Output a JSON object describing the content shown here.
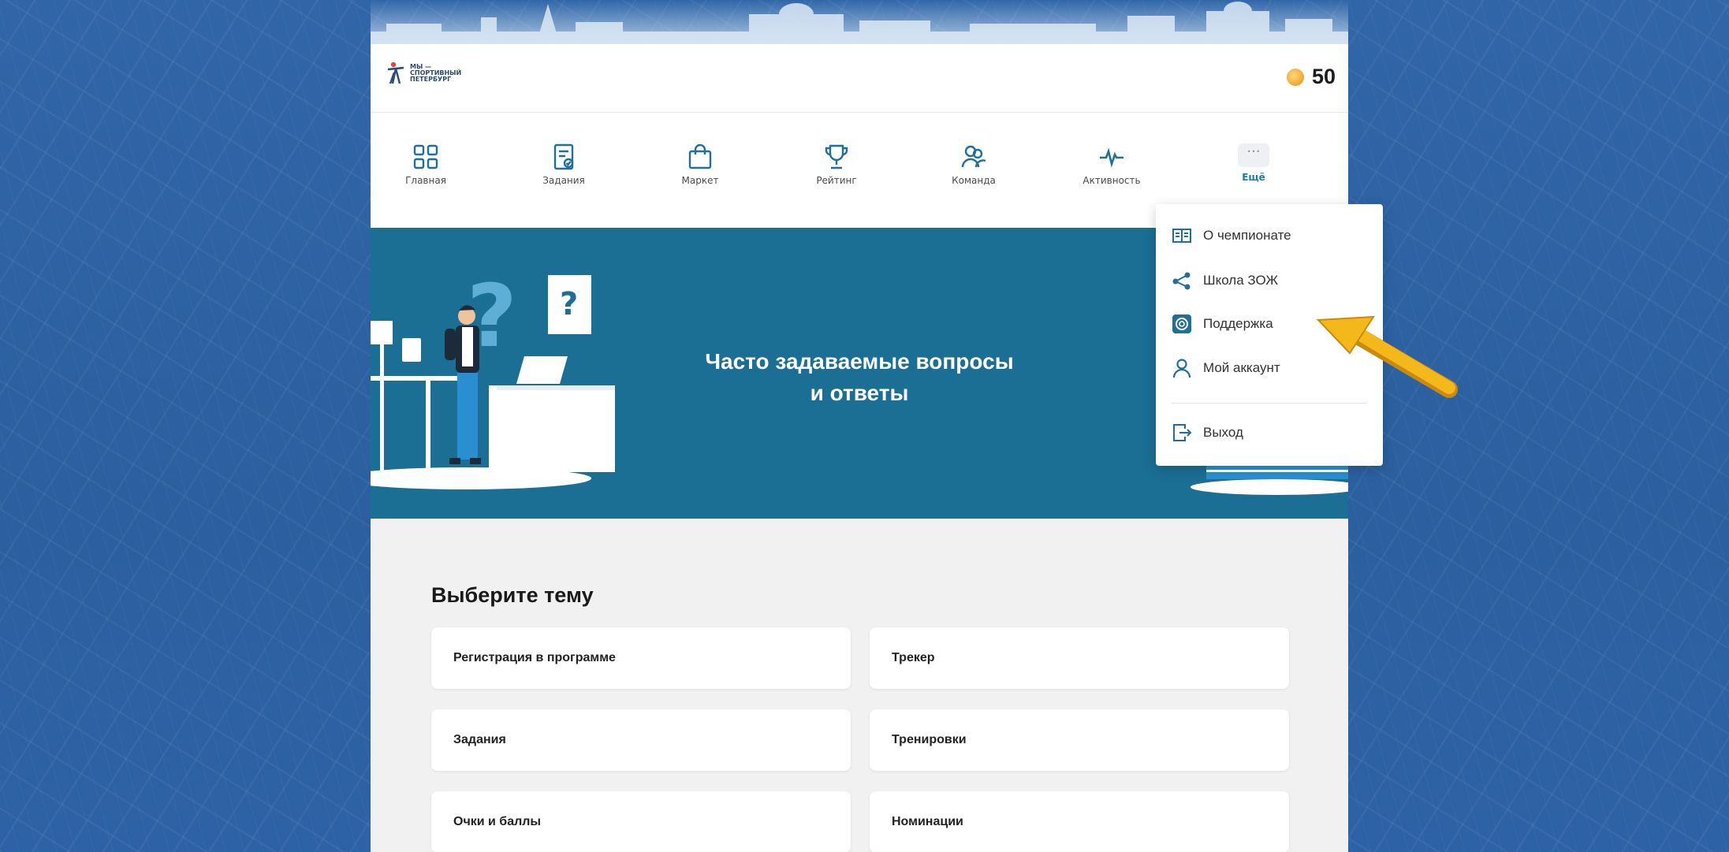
{
  "header": {
    "logo_text": "МЫ —\nСПОРТИВНЫЙ\nПЕТЕРБУРГ",
    "balance": "50"
  },
  "nav": {
    "items": [
      {
        "label": "Главная",
        "icon": "grid-icon"
      },
      {
        "label": "Задания",
        "icon": "task-icon"
      },
      {
        "label": "Маркет",
        "icon": "bag-icon"
      },
      {
        "label": "Рейтинг",
        "icon": "trophy-icon"
      },
      {
        "label": "Команда",
        "icon": "team-icon"
      },
      {
        "label": "Активность",
        "icon": "pulse-icon"
      },
      {
        "label": "Ещё",
        "icon": "more-icon"
      }
    ]
  },
  "hero": {
    "title_line1": "Часто задаваемые вопросы",
    "title_line2": "и ответы"
  },
  "content": {
    "title": "Выберите тему",
    "topics": [
      "Регистрация в программе",
      "Трекер",
      "Задания",
      "Тренировки",
      "Очки и баллы",
      "Номинации"
    ]
  },
  "dropdown": {
    "items": [
      {
        "label": "О чемпионате",
        "icon": "book-icon"
      },
      {
        "label": "Школа ЗОЖ",
        "icon": "share-icon"
      },
      {
        "label": "Поддержка",
        "icon": "support-icon"
      },
      {
        "label": "Мой аккаунт",
        "icon": "user-icon"
      },
      {
        "label": "Выход",
        "icon": "logout-icon"
      }
    ]
  },
  "colors": {
    "accent": "#1b6e94",
    "background": "#2d5f9e",
    "arrow": "#f5b81a"
  }
}
